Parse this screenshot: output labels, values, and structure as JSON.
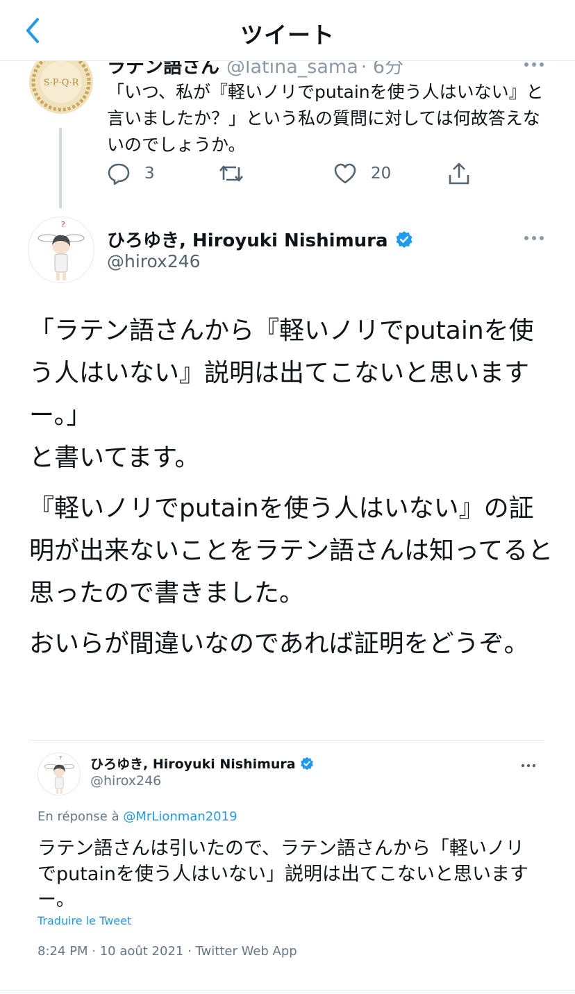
{
  "header": {
    "title": "ツイート"
  },
  "parent_tweet": {
    "author_name": "ラテン語さん",
    "handle": "@latina_sama",
    "time": "· 6分",
    "avatar_text": "S·P·Q·R",
    "text": "「いつ、私が『軽いノリでputainを使う人はいない』と言いましたか？」という私の質問に対しては何故答えないのでしょうか。",
    "replies": "3",
    "likes": "20"
  },
  "main_tweet": {
    "author_name": "ひろゆき, Hiroyuki Nishimura",
    "handle": "@hirox246",
    "paragraphs": [
      "「ラテン語さんから『軽いノリでputainを使う人はいない』説明は出てこないと思いますー。」\nと書いてます。",
      "『軽いノリでputainを使う人はいない』の証明が出来ないことをラテン語さんは知ってると思ったので書きました。",
      "おいらが間違いなのであれば証明をどうぞ。"
    ]
  },
  "quoted_tweet": {
    "author_name": "ひろゆき, Hiroyuki Nishimura",
    "handle": "@hirox246",
    "reply_prefix": "En réponse à",
    "reply_mention": "@MrLionman2019",
    "text": "ラテン語さんは引いたので、ラテン語さんから「軽いノリでputainを使う人はいない」説明は出てこないと思いますー。",
    "translate": "Traduire le Tweet",
    "meta": "8:24 PM · 10 août 2021 · Twitter Web App"
  },
  "colors": {
    "accent": "#1d9bf0",
    "text": "#0f1419",
    "secondary": "#536471",
    "border": "#e1e8ed"
  }
}
